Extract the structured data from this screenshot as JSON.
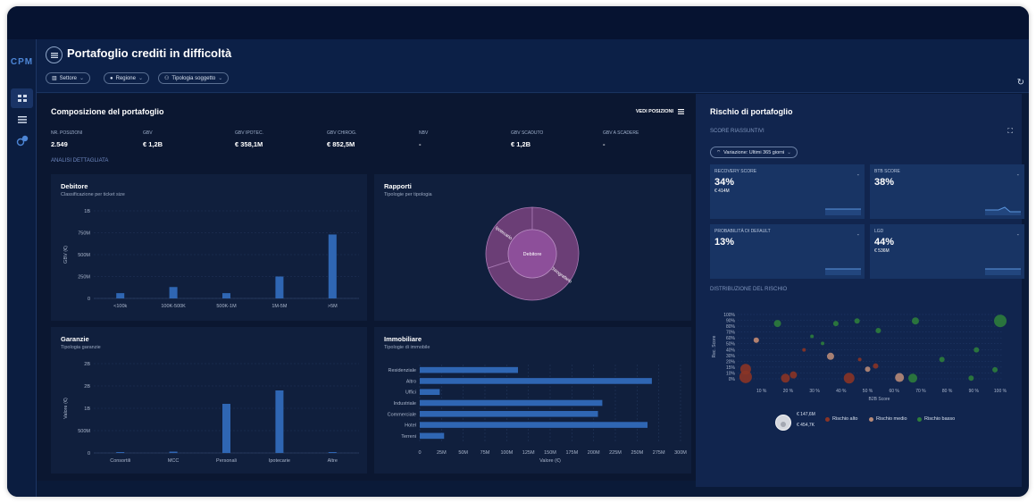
{
  "app": {
    "logo": "CPM"
  },
  "header": {
    "title": "Portafoglio crediti in difficoltà",
    "filters": [
      {
        "label": "Settore",
        "icon": "sector-icon"
      },
      {
        "label": "Regione",
        "icon": "location-pin-icon"
      },
      {
        "label": "Tipologia soggetto",
        "icon": "users-icon"
      }
    ],
    "refresh_icon": "refresh-icon"
  },
  "sidebar": {
    "items": [
      {
        "icon": "grid-icon",
        "active": true
      },
      {
        "icon": "list-icon",
        "active": false
      },
      {
        "icon": "users-badge-icon",
        "active": false
      }
    ]
  },
  "composition": {
    "title": "Composizione del portafoglio",
    "view_positions": "VEDI POSIZIONI",
    "kpis": [
      {
        "label": "NR. POSIZIONI",
        "value": "2.549"
      },
      {
        "label": "GBV",
        "value": "€ 1,2B"
      },
      {
        "label": "GBV IPOTEC.",
        "value": "€ 358,1M"
      },
      {
        "label": "GBV CHIROG.",
        "value": "€ 852,5M"
      },
      {
        "label": "NBV",
        "value": "-"
      },
      {
        "label": "GBV SCADUTO",
        "value": "€ 1,2B"
      },
      {
        "label": "GBV A SCADERE",
        "value": "-"
      }
    ],
    "detail_label": "ANALISI DETTAGLIATA"
  },
  "colors": {
    "bar": "#2f66b3",
    "donut_outer": "#6b3e76",
    "donut_inner": "#8d4f9a",
    "accent": "#2f66b3",
    "high": "#8a3426",
    "mid": "#b78a78",
    "low": "#2e7d3c"
  },
  "debitore": {
    "title": "Debitore",
    "subtitle": "Classificazione per ticket size",
    "chart_data": {
      "type": "bar",
      "categories": [
        "<100k",
        "100K-500K",
        "500K-1M",
        "1M-5M",
        ">5M"
      ],
      "values": [
        60,
        130,
        60,
        250,
        730
      ],
      "ylabel": "GBV (€)",
      "ylim": [
        0,
        1000
      ],
      "yticks": [
        {
          "v": 0,
          "label": "0"
        },
        {
          "v": 250,
          "label": "250M"
        },
        {
          "v": 500,
          "label": "500M"
        },
        {
          "v": 750,
          "label": "750M"
        },
        {
          "v": 1000,
          "label": "1B"
        }
      ]
    }
  },
  "rapporti": {
    "title": "Rapporti",
    "subtitle": "Tipologie per tipologia",
    "chart_data": {
      "type": "pie",
      "inner": [
        {
          "label": "Debitore",
          "value": 100
        }
      ],
      "outer": [
        {
          "label": "Ipotecario",
          "value": 30
        },
        {
          "label": "Chirografario",
          "value": 70
        }
      ]
    }
  },
  "garanzie": {
    "title": "Garanzie",
    "subtitle": "Tipologia garanzie",
    "chart_data": {
      "type": "bar",
      "categories": [
        "Consortili",
        "MCC",
        "Personali",
        "Ipotecarie",
        "Altre"
      ],
      "values": [
        0.02,
        0.03,
        1.1,
        1.4,
        0.02
      ],
      "ylabel": "Valore (€)",
      "ylim": [
        0,
        2
      ],
      "yticks": [
        {
          "v": 0,
          "label": "0"
        },
        {
          "v": 0.5,
          "label": "500M"
        },
        {
          "v": 1,
          "label": "1B"
        },
        {
          "v": 1.5,
          "label": "2B"
        },
        {
          "v": 2,
          "label": "2B"
        }
      ]
    }
  },
  "immobiliare": {
    "title": "Immobiliare",
    "subtitle": "Tipologie di immobile",
    "chart_data": {
      "type": "bar",
      "orientation": "horizontal",
      "categories": [
        "Residenziale",
        "Altro",
        "Uffici",
        "Industriale",
        "Commerciale",
        "Hotel",
        "Terreni"
      ],
      "values": [
        113,
        267,
        23,
        210,
        205,
        262,
        28
      ],
      "xlabel": "Valore (€)",
      "xlim": [
        0,
        300
      ],
      "xticks": [
        "0",
        "25M",
        "50M",
        "75M",
        "100M",
        "125M",
        "150M",
        "175M",
        "200M",
        "225M",
        "250M",
        "275M",
        "300M"
      ]
    }
  },
  "risk": {
    "title": "Rischio di portafoglio",
    "summary_label": "SCORE RIASSUNTIVI",
    "expand_icon": "expand-icon",
    "variation": "Variazione: Ultimi 365 giorni",
    "kpis": [
      {
        "label": "RECOVERY SCORE",
        "value": "34%",
        "sub": "€ 414M",
        "dash": "-"
      },
      {
        "label": "BTB SCORE",
        "value": "38%",
        "sub": "",
        "dash": "-"
      },
      {
        "label": "PROBABILITÀ DI DEFAULT",
        "value": "13%",
        "sub": "",
        "dash": "-"
      },
      {
        "label": "LGD",
        "value": "44%",
        "sub": "€ 536M",
        "dash": "-"
      }
    ],
    "distribution_label": "DISTRIBUZIONE DEL RISCHIO"
  },
  "scatter": {
    "chart_data": {
      "type": "scatter",
      "xlabel": "B2B Score",
      "ylabel": "Rec. Score",
      "xticks": [
        "10 %",
        "20 %",
        "30 %",
        "40 %",
        "50 %",
        "60 %",
        "70 %",
        "80 %",
        "90 %",
        "100 %"
      ],
      "yticks": [
        "0%",
        "10%",
        "15%",
        "20%",
        "30%",
        "40%",
        "50%",
        "60%",
        "70%",
        "80%",
        "90%",
        "100%"
      ],
      "series": [
        {
          "name": "Rischio alto",
          "points": [
            [
              3,
              15,
              6
            ],
            [
              3,
              3,
              7
            ],
            [
              18,
              1,
              5
            ],
            [
              21,
              6,
              4
            ],
            [
              42,
              1,
              6
            ],
            [
              46,
              30,
              2
            ],
            [
              52,
              20,
              3
            ],
            [
              25,
              45,
              2
            ],
            [
              7,
              60,
              3
            ]
          ]
        },
        {
          "name": "Rischio medio",
          "points": [
            [
              7,
              60,
              3
            ],
            [
              35,
              35,
              4
            ],
            [
              49,
              15,
              3
            ],
            [
              61,
              2,
              5
            ]
          ]
        },
        {
          "name": "Rischio basso",
          "points": [
            [
              15,
              86,
              4
            ],
            [
              37,
              86,
              3
            ],
            [
              67,
              90,
              4
            ],
            [
              99,
              90,
              7
            ],
            [
              90,
              45,
              3
            ],
            [
              53,
              75,
              3
            ],
            [
              32,
              55,
              2
            ],
            [
              45,
              90,
              3
            ],
            [
              88,
              1,
              3
            ],
            [
              66,
              1,
              5
            ],
            [
              77,
              30,
              3
            ],
            [
              97,
              14,
              3
            ],
            [
              28,
              66,
              2
            ]
          ]
        }
      ],
      "size_legend": [
        {
          "label": "€ 147,6M"
        },
        {
          "label": "€ 454,7K"
        }
      ]
    }
  }
}
